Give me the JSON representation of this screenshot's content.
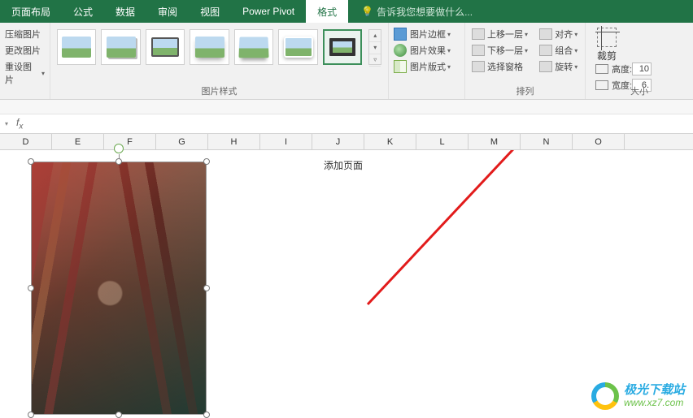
{
  "tabs": {
    "layout": "页面布局",
    "formulas": "公式",
    "data": "数据",
    "review": "审阅",
    "view": "视图",
    "powerpivot": "Power Pivot",
    "format": "格式"
  },
  "tellme": "告诉我您想要做什么...",
  "adjust": {
    "compress": "压缩图片",
    "change": "更改图片",
    "reset": "重设图片"
  },
  "groups": {
    "styles": "图片样式",
    "arrange": "排列",
    "size": "大小"
  },
  "picfmt": {
    "border": "图片边框",
    "effects": "图片效果",
    "layout": "图片版式"
  },
  "arrange": {
    "bringfwd": "上移一层",
    "sendback": "下移一层",
    "selection": "选择窗格",
    "align": "对齐",
    "group": "组合",
    "rotate": "旋转"
  },
  "size": {
    "crop": "裁剪",
    "height_label": "高度:",
    "height_val": "10",
    "width_label": "宽度:",
    "width_val": "6."
  },
  "columns": [
    "D",
    "E",
    "F",
    "G",
    "H",
    "I",
    "J",
    "K",
    "L",
    "M",
    "N",
    "O"
  ],
  "cell_text": "添加页面",
  "watermark": {
    "title": "极光下载站",
    "url": "www.xz7.com"
  }
}
